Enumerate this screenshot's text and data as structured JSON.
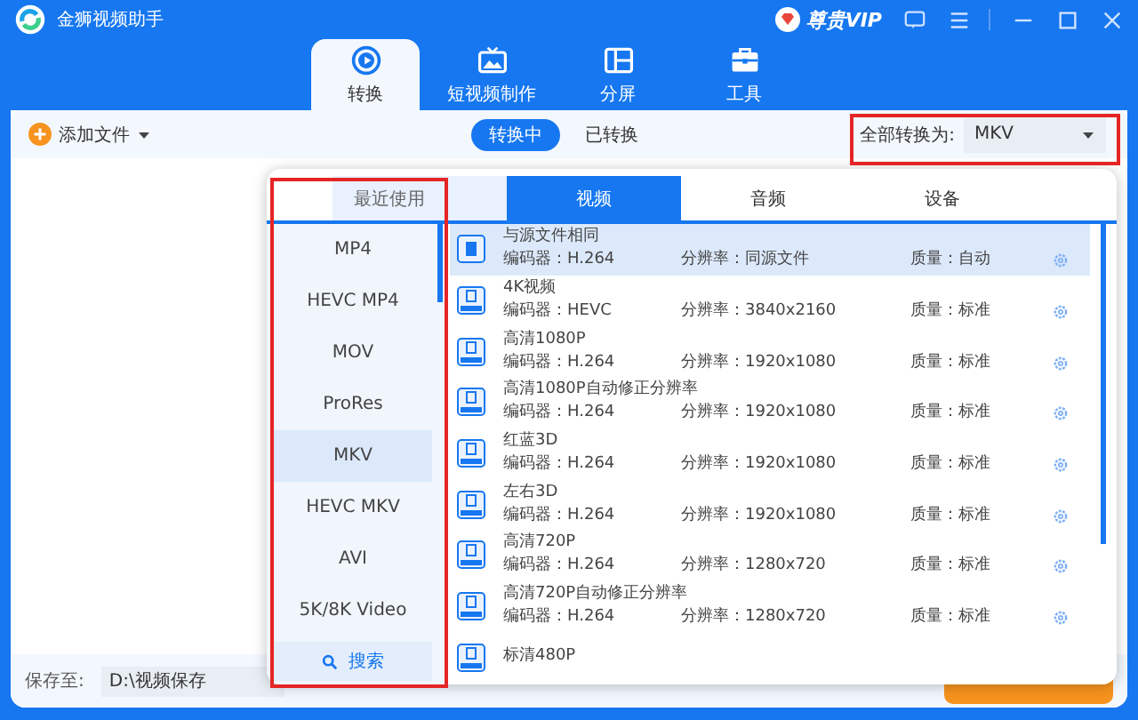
{
  "window": {
    "title": "金狮视频助手",
    "vip": "尊贵VIP"
  },
  "nav_tabs": [
    {
      "label": "转换",
      "selected": true
    },
    {
      "label": "短视频制作",
      "selected": false
    },
    {
      "label": "分屏",
      "selected": false
    },
    {
      "label": "工具",
      "selected": false
    }
  ],
  "toolbar": {
    "add_file": "添加文件",
    "segments": [
      {
        "label": "转换中",
        "selected": true
      },
      {
        "label": "已转换",
        "selected": false
      }
    ],
    "convert_all_label": "全部转换为:",
    "convert_all_value": "MKV"
  },
  "footer": {
    "save_label": "保存至:",
    "save_path": "D:\\视频保存"
  },
  "format_popup": {
    "tabs": [
      {
        "label": "最近使用",
        "selected": false
      },
      {
        "label": "视频",
        "selected": true
      },
      {
        "label": "音频",
        "selected": false
      },
      {
        "label": "设备",
        "selected": false
      }
    ],
    "formats": [
      {
        "label": "MP4",
        "selected": false
      },
      {
        "label": "HEVC MP4",
        "selected": false
      },
      {
        "label": "MOV",
        "selected": false
      },
      {
        "label": "ProRes",
        "selected": false
      },
      {
        "label": "MKV",
        "selected": true
      },
      {
        "label": "HEVC MKV",
        "selected": false
      },
      {
        "label": "AVI",
        "selected": false
      },
      {
        "label": "5K/8K Video",
        "selected": false
      }
    ],
    "search": "搜索",
    "presets": [
      {
        "name": "与源文件相同",
        "codec": "编码器：H.264",
        "resolution": "分辨率：同源文件",
        "quality": "质量：自动",
        "selected": true
      },
      {
        "name": "4K视频",
        "codec": "编码器：HEVC",
        "resolution": "分辨率：3840x2160",
        "quality": "质量：标准",
        "selected": false
      },
      {
        "name": "高清1080P",
        "codec": "编码器：H.264",
        "resolution": "分辨率：1920x1080",
        "quality": "质量：标准",
        "selected": false
      },
      {
        "name": "高清1080P自动修正分辨率",
        "codec": "编码器：H.264",
        "resolution": "分辨率：1920x1080",
        "quality": "质量：标准",
        "selected": false
      },
      {
        "name": "红蓝3D",
        "codec": "编码器：H.264",
        "resolution": "分辨率：1920x1080",
        "quality": "质量：标准",
        "selected": false
      },
      {
        "name": "左右3D",
        "codec": "编码器：H.264",
        "resolution": "分辨率：1920x1080",
        "quality": "质量：标准",
        "selected": false
      },
      {
        "name": "高清720P",
        "codec": "编码器：H.264",
        "resolution": "分辨率：1280x720",
        "quality": "质量：标准",
        "selected": false
      },
      {
        "name": "高清720P自动修正分辨率",
        "codec": "编码器：H.264",
        "resolution": "分辨率：1280x720",
        "quality": "质量：标准",
        "selected": false
      },
      {
        "name": "标清480P",
        "selected": false
      }
    ]
  }
}
